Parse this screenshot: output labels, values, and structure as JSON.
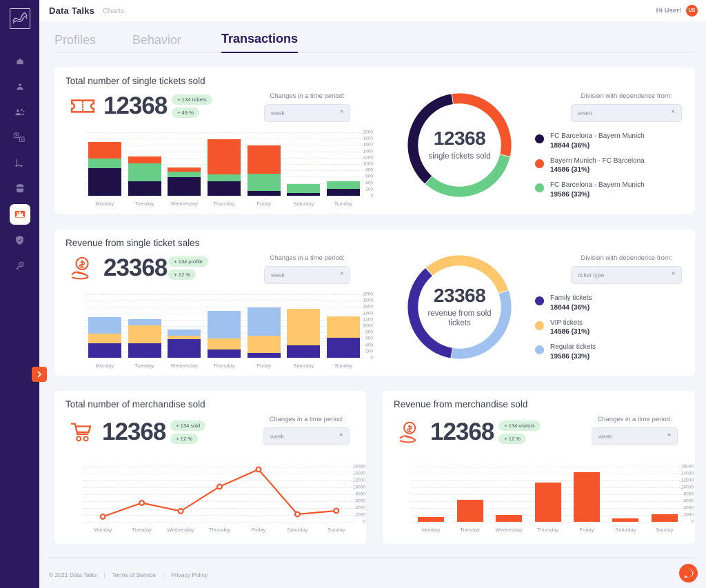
{
  "topbar": {
    "brand": "Data Talks",
    "section": "Charts",
    "greeting": "Hi User!",
    "avatar_initials": "US"
  },
  "tabs": [
    {
      "label": "Profiles",
      "active": false
    },
    {
      "label": "Behavior",
      "active": false
    },
    {
      "label": "Transactions",
      "active": true
    }
  ],
  "sidebar": {
    "items": [
      {
        "icon": "home-icon",
        "active": false
      },
      {
        "icon": "user-icon",
        "active": false
      },
      {
        "icon": "group-icon",
        "active": false
      },
      {
        "icon": "dice-icon",
        "active": false
      },
      {
        "icon": "funnel-icon",
        "active": false
      },
      {
        "icon": "database-icon",
        "active": false
      },
      {
        "icon": "charts-icon",
        "active": true
      },
      {
        "icon": "shield-check-icon",
        "active": false
      },
      {
        "icon": "key-icon",
        "active": false
      }
    ],
    "toggle_icon": "chevron-right-icon"
  },
  "colors": {
    "navy": "#2b1a5e",
    "orange": "#f4552a",
    "green": "#68ce87",
    "purple": "#4b3aa8",
    "yellow": "#ffc76b",
    "light_blue": "#9ec1ef",
    "badge_bg": "#d8f2de"
  },
  "cards": {
    "tickets_sold": {
      "title": "Total number of single tickets sold",
      "kpi_value": "12368",
      "kpi_icon": "ticket-icon",
      "badges": [
        "+ 134 tickets",
        "+ 49 %"
      ],
      "period_label": "Changes in a time period:",
      "period_value": "week",
      "division_label": "Division with dependence from:",
      "division_value": "event",
      "donut_center_value": "12368",
      "donut_center_label": "single tickets sold",
      "legend": [
        {
          "name": "FC Barcelona - Bayern Munich",
          "value": "18844 (36%)",
          "color": "#1f1147"
        },
        {
          "name": "Bayern Munich - FC Barcelona",
          "value": "14586 (31%)",
          "color": "#f4552a"
        },
        {
          "name": "FC Barcelona - Bayern Munich",
          "value": "19586 (33%)",
          "color": "#68ce87"
        }
      ]
    },
    "ticket_revenue": {
      "title": "Revenue from single ticket sales",
      "kpi_value": "23368",
      "kpi_icon": "hand-money-icon",
      "badges": [
        "+ 134 profile",
        "+ 12 %"
      ],
      "period_label": "Changes in a time period:",
      "period_value": "week",
      "division_label": "Division with dependence from:",
      "division_value": "ticket type",
      "donut_center_value": "23368",
      "donut_center_label": "revenue from sold tickets",
      "legend": [
        {
          "name": "Family tickets",
          "value": "18844 (36%)",
          "color": "#3c2a9e"
        },
        {
          "name": "VIP tickets",
          "value": "14586 (31%)",
          "color": "#ffc76b"
        },
        {
          "name": "Regular tickets",
          "value": "19586 (33%)",
          "color": "#9ec1ef"
        }
      ]
    },
    "merch_sold": {
      "title": "Total number of merchandise sold",
      "kpi_value": "12368",
      "kpi_icon": "cart-icon",
      "badges": [
        "+ 134 sold",
        "+ 12 %"
      ],
      "period_label": "Changes in a time period:",
      "period_value": "week"
    },
    "merch_revenue": {
      "title": "Revenue from merchandise sold",
      "kpi_value": "12368",
      "kpi_icon": "hand-money-icon",
      "badges": [
        "+ 134 visitors",
        "+ 12 %"
      ],
      "period_label": "Changes in a time period:",
      "period_value": "week"
    }
  },
  "chart_data": [
    {
      "id": "tickets_sold_bars",
      "type": "bar",
      "stacked": true,
      "title": "Total number of single tickets sold",
      "categories": [
        "Monday",
        "Tuesday",
        "Wednesday",
        "Thursday",
        "Friday",
        "Saturday",
        "Sunday"
      ],
      "series": [
        {
          "name": "FC Barcelona - Bayern Munich",
          "color": "#1f1147",
          "values": [
            860,
            460,
            580,
            450,
            160,
            90,
            220
          ]
        },
        {
          "name": "FC Barcelona - Bayern Munich",
          "color": "#68ce87",
          "values": [
            310,
            560,
            180,
            220,
            540,
            290,
            240
          ]
        },
        {
          "name": "Bayern Munich - FC Barcelona",
          "color": "#f4552a",
          "values": [
            520,
            210,
            140,
            1110,
            890,
            0,
            0
          ]
        }
      ],
      "ylim": [
        0,
        2000
      ],
      "yticks": [
        0,
        200,
        400,
        600,
        800,
        1000,
        1200,
        1400,
        1600,
        1800,
        2000
      ],
      "xlabel": "",
      "ylabel": "",
      "grid": true,
      "legend": "none"
    },
    {
      "id": "tickets_sold_donut",
      "type": "pie",
      "title": "single tickets sold",
      "center_value": "12368",
      "labels": [
        "FC Barcelona - Bayern Munich",
        "Bayern Munich - FC Barcelona",
        "FC Barcelona - Bayern Munich"
      ],
      "values": [
        18844,
        14586,
        19586
      ],
      "percents": [
        36,
        31,
        33
      ],
      "colors": [
        "#1f1147",
        "#f4552a",
        "#68ce87"
      ],
      "legend": "right"
    },
    {
      "id": "ticket_revenue_bars",
      "type": "bar",
      "stacked": true,
      "title": "Revenue from single ticket sales",
      "categories": [
        "Monday",
        "Tuesday",
        "Wednesday",
        "Thursday",
        "Friday",
        "Saturday",
        "Sunday"
      ],
      "series": [
        {
          "name": "Family tickets",
          "color": "#3c2a9e",
          "values": [
            450,
            460,
            580,
            270,
            160,
            400,
            620
          ]
        },
        {
          "name": "VIP tickets",
          "color": "#ffc76b",
          "values": [
            320,
            560,
            120,
            330,
            530,
            1140,
            680
          ]
        },
        {
          "name": "Regular tickets",
          "color": "#9ec1ef",
          "values": [
            520,
            200,
            200,
            870,
            900,
            0,
            0
          ]
        }
      ],
      "ylim": [
        0,
        2000
      ],
      "yticks": [
        0,
        200,
        400,
        600,
        800,
        1000,
        1200,
        1400,
        1600,
        1800,
        2000
      ],
      "xlabel": "",
      "ylabel": "",
      "grid": true,
      "legend": "none"
    },
    {
      "id": "ticket_revenue_donut",
      "type": "pie",
      "title": "revenue from sold tickets",
      "center_value": "23368",
      "labels": [
        "Family tickets",
        "VIP tickets",
        "Regular tickets"
      ],
      "values": [
        18844,
        14586,
        19586
      ],
      "percents": [
        36,
        31,
        33
      ],
      "colors": [
        "#3c2a9e",
        "#ffc76b",
        "#9ec1ef"
      ],
      "legend": "right"
    },
    {
      "id": "merch_sold_line",
      "type": "line",
      "title": "Total number of merchandise sold",
      "categories": [
        "Monday",
        "Tuesday",
        "Wednesday",
        "Thursday",
        "Friday",
        "Saturday",
        "Sunday"
      ],
      "values": [
        1500,
        5500,
        3100,
        10200,
        15200,
        2200,
        3200
      ],
      "color": "#f4552a",
      "ylim": [
        0,
        16000
      ],
      "yticks": [
        0,
        2000,
        4000,
        6000,
        8000,
        10000,
        12000,
        14000,
        16000
      ],
      "markers": true,
      "grid": true,
      "legend": "none"
    },
    {
      "id": "merch_revenue_bars",
      "type": "bar",
      "stacked": false,
      "title": "Revenue from merchandise sold",
      "categories": [
        "Monday",
        "Tuesday",
        "Wednesday",
        "Thursday",
        "Friday",
        "Saturday",
        "Sunday"
      ],
      "values": [
        1500,
        6500,
        2100,
        11500,
        14500,
        1100,
        2200
      ],
      "color": "#f4552a",
      "ylim": [
        0,
        16000
      ],
      "yticks": [
        0,
        2000,
        4000,
        6000,
        8000,
        10000,
        12000,
        14000,
        16000
      ],
      "grid": true,
      "legend": "none"
    }
  ],
  "footer": {
    "copyright": "© 2021 Data Talks",
    "terms": "Terms of Service",
    "privacy": "Privacy Policy",
    "chat_icon": "chat-bubble-icon"
  }
}
